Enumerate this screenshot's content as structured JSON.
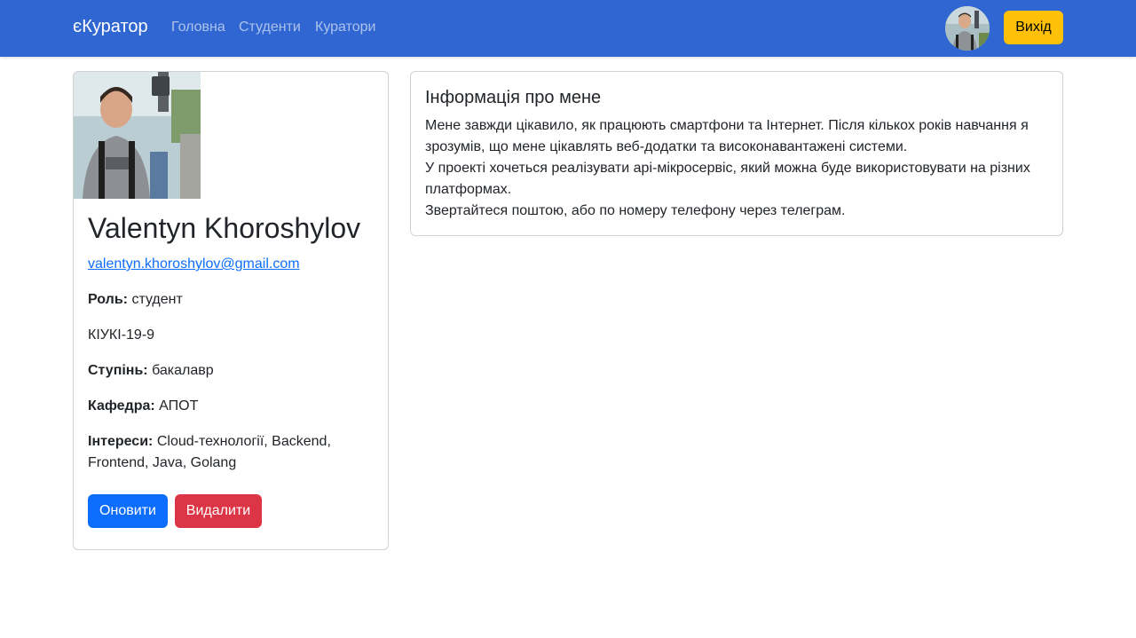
{
  "navbar": {
    "brand": "єКуратор",
    "links": [
      "Головна",
      "Студенти",
      "Куратори"
    ],
    "logout_label": "Вихід"
  },
  "profile": {
    "name": "Valentyn Khoroshylov",
    "email": "valentyn.khoroshylov@gmail.com",
    "role_label": "Роль:",
    "role_value": "студент",
    "group": "КІУКІ-19-9",
    "degree_label": "Ступінь:",
    "degree_value": "бакалавр",
    "department_label": "Кафедра:",
    "department_value": "АПОТ",
    "interests_label": "Інтереси:",
    "interests_value": "Cloud-технології, Backend, Frontend, Java, Golang",
    "update_label": "Оновити",
    "delete_label": "Видалити"
  },
  "about": {
    "title": "Інформація про мене",
    "lines": [
      "Мене завжди цікавило, як працюють смартфони та Інтернет. Після кількох років навчання я зрозумів, що мене цікавлять веб-додатки та високонавантажені системи.",
      "У проекті хочеться реалізувати api-мікросервіс, який можна буде використовувати на різних платформах.",
      "Звертайтеся поштою, або по номеру телефону через телеграм."
    ]
  },
  "colors": {
    "navbar": "#3066d1",
    "logout": "#ffc107",
    "primary": "#0d6efd",
    "danger": "#dc3545"
  }
}
